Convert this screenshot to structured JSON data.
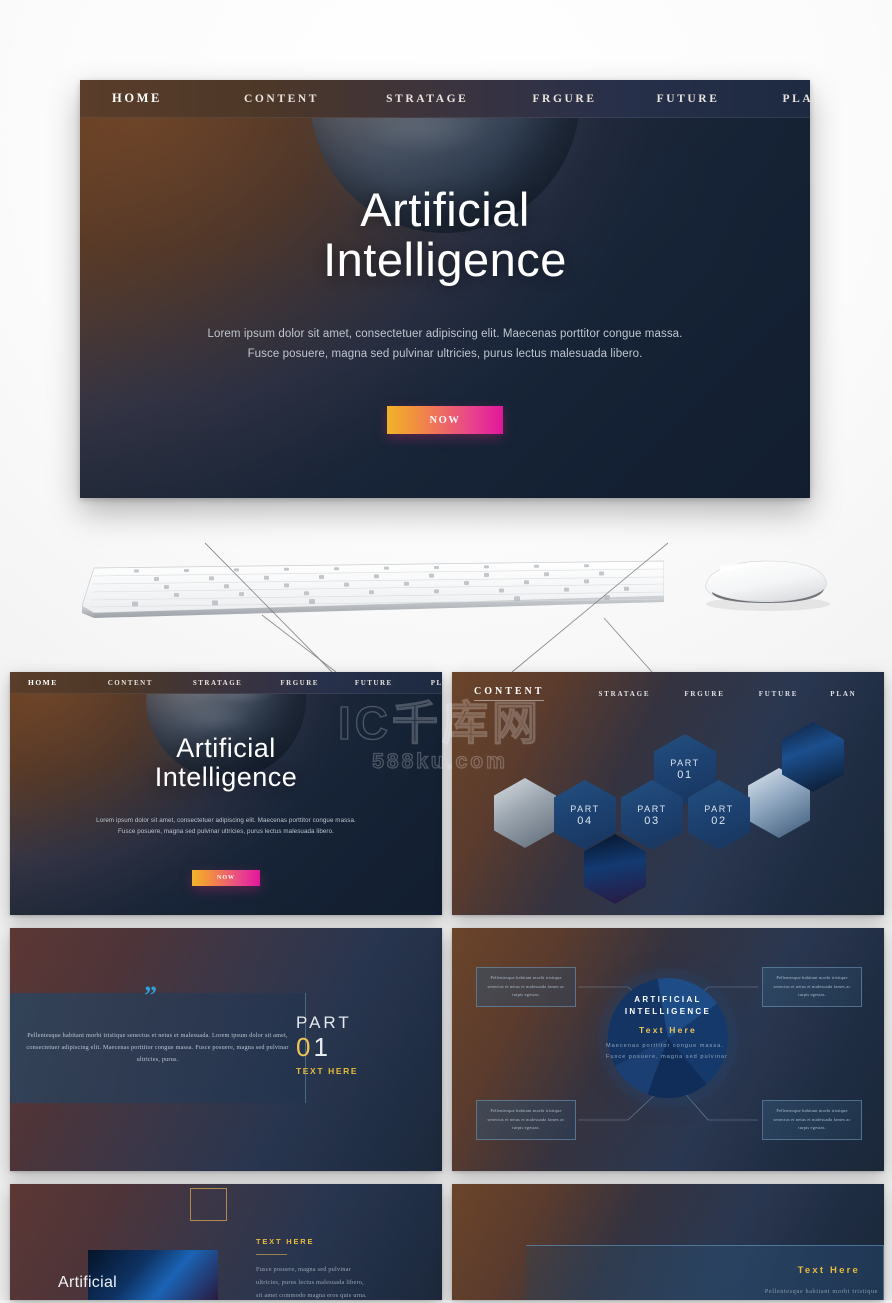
{
  "watermark": {
    "main": "IC千库网",
    "sub": "588ku.com"
  },
  "hero": {
    "nav": {
      "home_icon": "home-icon",
      "items": [
        {
          "label": "HOME"
        },
        {
          "label": "CONTENT"
        },
        {
          "label": "STRATAGE"
        },
        {
          "label": "FRGURE"
        },
        {
          "label": "FUTURE"
        },
        {
          "label": "PLAN"
        }
      ]
    },
    "title_line1": "Artificial",
    "title_line2": "Intelligence",
    "subtitle_line1": "Lorem ipsum dolor sit amet, consectetuer adipiscing elit. Maecenas porttitor congue massa.",
    "subtitle_line2": "Fusce posuere, magna sed pulvinar ultricies, purus lectus malesuada libero.",
    "cta_label": "NOW",
    "colors": {
      "nav_start": "#5a3d2a",
      "nav_end": "#1d2a41",
      "cta_start": "#f0b429",
      "cta_end": "#e2179a",
      "bg_warm": "#6a4429",
      "bg_navy": "#172334"
    }
  },
  "hardware": {
    "keyboard": "keyboard-image",
    "mouse": "mouse-image"
  },
  "thumbnails": [
    {
      "id": "slide-hero",
      "nav": {
        "items": [
          {
            "label": "HOME"
          },
          {
            "label": "CONTENT"
          },
          {
            "label": "STRATAGE"
          },
          {
            "label": "FRGURE"
          },
          {
            "label": "FUTURE"
          },
          {
            "label": "PLAN"
          }
        ]
      },
      "title_line1": "Artificial",
      "title_line2": "Intelligence",
      "subtitle_line1": "Lorem ipsum dolor sit amet, consectetuer adipiscing elit. Maecenas porttitor congue massa.",
      "subtitle_line2": "Fusce posuere, magna sed pulvinar ultricies, purus lectus malesuada libero.",
      "cta_label": "NOW"
    },
    {
      "id": "slide-content",
      "nav": {
        "active": "CONTENT",
        "items": [
          {
            "label": "STRATAGE"
          },
          {
            "label": "FRGURE"
          },
          {
            "label": "FUTURE"
          },
          {
            "label": "PLAN"
          }
        ]
      },
      "hexagons": [
        {
          "word": "PART",
          "num": "01"
        },
        {
          "word": "PART",
          "num": "02"
        },
        {
          "word": "PART",
          "num": "03"
        },
        {
          "word": "PART",
          "num": "04"
        }
      ],
      "photo_hexes": [
        "team-photo",
        "bridge-night-photo",
        "office-photo",
        "ai-face-photo"
      ]
    },
    {
      "id": "slide-part-01",
      "quote_glyph": "”",
      "body": "Pellentesque habitant morbi tristique senectus et netus et malesuada. Lorem ipsum dolor sit amet, consectetuer adipiscing elit. Maecenas porttitor congue massa. Fusce posuere, magna sed pulvinar ultricies, purus.",
      "part_word": "PART",
      "part_num_0": "0",
      "part_num_1": "1",
      "text_here": "TEXT HERE"
    },
    {
      "id": "slide-donut",
      "center_title_line1": "ARTIFICIAL",
      "center_title_line2": "INTELLIGENCE",
      "center_accent": "Text Here",
      "center_body": "Maecenas porttitor congue massa. Fusce posuere, magna sed pulvinar",
      "boxes": [
        {
          "text": "Pellentesque habitant morbi tristique senectus et netus et malesuada fames ac turpis egestas."
        },
        {
          "text": "Pellentesque habitant morbi tristique senectus et netus et malesuada fames ac turpis egestas."
        },
        {
          "text": "Pellentesque habitant morbi tristique senectus et netus et malesuada fames ac turpis egestas."
        },
        {
          "text": "Pellentesque habitant morbi tristique senectus et netus et malesuada fames ac turpis egestas."
        }
      ]
    },
    {
      "id": "slide-text-image",
      "image_caption": "Artificial",
      "heading": "TEXT HERE",
      "body_line1": "Fusce posuere, magna sed pulvinar",
      "body_line2": "ultricies, purus lectus malesuada libero,",
      "body_line3": "sit amet commodo magna eros quis urna."
    },
    {
      "id": "slide-text-panel",
      "heading": "Text Here",
      "body": "Pellentesque habitant morbi tristique"
    }
  ]
}
